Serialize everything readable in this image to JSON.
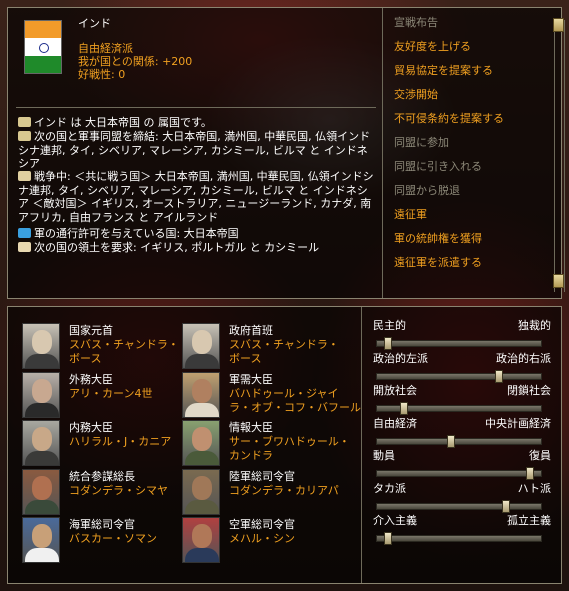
{
  "country": {
    "name": "インド",
    "ideology": "自由経済派",
    "relation": "我が国との関係: +200",
    "belligerence": "好戦性: 0"
  },
  "info": [
    {
      "icon": "puppet-icon",
      "segments": [
        [
          "インド は 大日本帝国 の 属国です。",
          "white"
        ]
      ]
    },
    {
      "icon": "alliance-icon",
      "segments": [
        [
          "次の国と軍事同盟を締結: 大日本帝国, 満州国, 中華民国, 仏領インドシナ連邦, タイ, シベリア, マレーシア, カシミール, ビルマ と インドネシア",
          "white"
        ]
      ]
    },
    {
      "icon": "war-icon",
      "segments": [
        [
          "戦争中: ＜共に戦う国＞ 大日本帝国, 満州国, 中華民国, 仏領インドシナ連邦, タイ, シベリア, マレーシア, カシミール, ビルマ と インドネシア ＜敵対国＞ イギリス, オーストラリア, ニュージーランド, カナダ, 南アフリカ, 自由フランス と アイルランド",
          "white"
        ]
      ]
    },
    {
      "icon": "military-access-icon",
      "segments": [
        [
          "軍の通行許可を与えている国: 大日本帝国",
          "white"
        ]
      ]
    },
    {
      "icon": "claim-icon",
      "segments": [
        [
          "次の国の領土を要求: イギリス, ポルトガル と カシミール",
          "white"
        ]
      ]
    }
  ],
  "menu": [
    {
      "label": "宣戦布告",
      "enabled": false
    },
    {
      "label": "友好度を上げる",
      "enabled": true
    },
    {
      "label": "貿易協定を提案する",
      "enabled": true
    },
    {
      "label": "交渉開始",
      "enabled": true
    },
    {
      "label": "不可侵条約を提案する",
      "enabled": true
    },
    {
      "label": "同盟に参加",
      "enabled": false
    },
    {
      "label": "同盟に引き入れる",
      "enabled": false
    },
    {
      "label": "同盟から脱退",
      "enabled": false
    },
    {
      "label": "遠征軍",
      "enabled": true
    },
    {
      "label": "軍の統帥権を獲得",
      "enabled": true
    },
    {
      "label": "遠征軍を派遣する",
      "enabled": true
    }
  ],
  "ministers": [
    {
      "title": "国家元首",
      "name": "スバス・チャンドラ・ボース",
      "line1": "スバス・チャンドラ・",
      "line2": "ボース"
    },
    {
      "title": "政府首班",
      "name": "スバス・チャンドラ・ボース",
      "line1": "スバス・チャンドラ・",
      "line2": "ボース"
    },
    {
      "title": "外務大臣",
      "name": "アリ・カーン4世",
      "line1": "アリ・カーン4世",
      "line2": ""
    },
    {
      "title": "軍需大臣",
      "name": "バハドゥール・ジャイラ・オブ・コフ・バフール",
      "line1": "バハドゥール・ジャイ",
      "line2": "ラ・オブ・コフ・バフール"
    },
    {
      "title": "内務大臣",
      "name": "ハリラル・J・カニア",
      "line1": "ハリラル・J・カニア",
      "line2": ""
    },
    {
      "title": "情報大臣",
      "name": "サー・ブワハドゥール・カンドラ",
      "line1": "サー・ブワハドゥール・",
      "line2": "カンドラ"
    },
    {
      "title": "統合参謀総長",
      "name": "コダンデラ・シマヤ",
      "line1": "コダンデラ・シマヤ",
      "line2": ""
    },
    {
      "title": "陸軍総司令官",
      "name": "コダンデラ・カリアパ",
      "line1": "コダンデラ・カリアパ",
      "line2": ""
    },
    {
      "title": "海軍総司令官",
      "name": "バスカー・ソマン",
      "line1": "バスカー・ソマン",
      "line2": ""
    },
    {
      "title": "空軍総司令官",
      "name": "メハル・シン",
      "line1": "メハル・シン",
      "line2": ""
    }
  ],
  "policies": [
    {
      "left": "民主的",
      "right": "独裁的",
      "value": 0.05
    },
    {
      "left": "政治的左派",
      "right": "政治的右派",
      "value": 0.75
    },
    {
      "left": "開放社会",
      "right": "閉鎖社会",
      "value": 0.15
    },
    {
      "left": "自由経済",
      "right": "中央計画経済",
      "value": 0.45
    },
    {
      "left": "動員",
      "right": "復員",
      "value": 0.95
    },
    {
      "left": "タカ派",
      "right": "ハト派",
      "value": 0.8
    },
    {
      "left": "介入主義",
      "right": "孤立主義",
      "value": 0.05
    }
  ],
  "colors": {
    "highlight": "#f0a020",
    "text": "#ffffff",
    "disabled": "#8c8878",
    "flag_saffron": "#f29b2a",
    "flag_green": "#1f8a2a"
  }
}
